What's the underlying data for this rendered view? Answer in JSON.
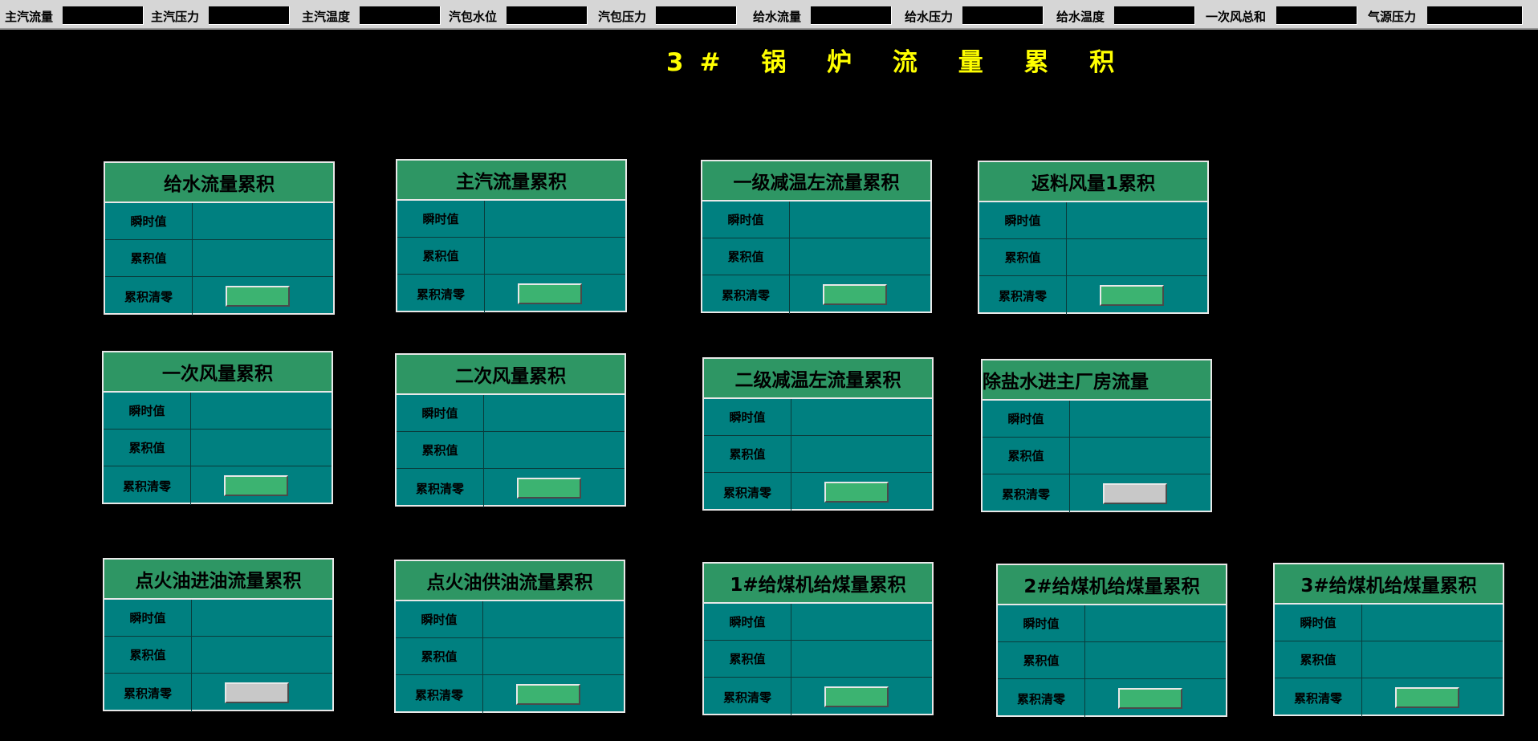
{
  "topbar": {
    "items": [
      {
        "label": "主汽流量"
      },
      {
        "label": "主汽压力"
      },
      {
        "label": "主汽温度"
      },
      {
        "label": "汽包水位"
      },
      {
        "label": "汽包压力"
      },
      {
        "label": "给水流量"
      },
      {
        "label": "给水压力"
      },
      {
        "label": "给水温度"
      },
      {
        "label": "一次风总和"
      },
      {
        "label": "气源压力"
      }
    ]
  },
  "title": "3# 锅 炉 流 量 累 积",
  "row_labels": {
    "instant": "瞬时值",
    "accum": "累积值",
    "reset": "累积清零"
  },
  "colors": {
    "reset_active": "#3cb371",
    "reset_inactive": "#c8c8c8",
    "panel_body": "#008080",
    "panel_head": "#2e9664",
    "title": "#ffff00"
  },
  "panels": [
    {
      "title": "给水流量累积",
      "reset_state": "active"
    },
    {
      "title": "主汽流量累积",
      "reset_state": "active"
    },
    {
      "title": "一级减温左流量累积",
      "reset_state": "active"
    },
    {
      "title": "返料风量1累积",
      "reset_state": "active"
    },
    {
      "title": "一次风量累积",
      "reset_state": "active"
    },
    {
      "title": "二次风量累积",
      "reset_state": "active"
    },
    {
      "title": "二级减温左流量累积",
      "reset_state": "active"
    },
    {
      "title": "除盐水进主厂房流量",
      "reset_state": "inactive"
    },
    {
      "title": "点火油进油流量累积",
      "reset_state": "inactive"
    },
    {
      "title": "点火油供油流量累积",
      "reset_state": "active"
    },
    {
      "title": "1#给煤机给煤量累积",
      "reset_state": "active"
    },
    {
      "title": "2#给煤机给煤量累积",
      "reset_state": "active"
    },
    {
      "title": "3#给煤机给煤量累积",
      "reset_state": "active"
    }
  ]
}
